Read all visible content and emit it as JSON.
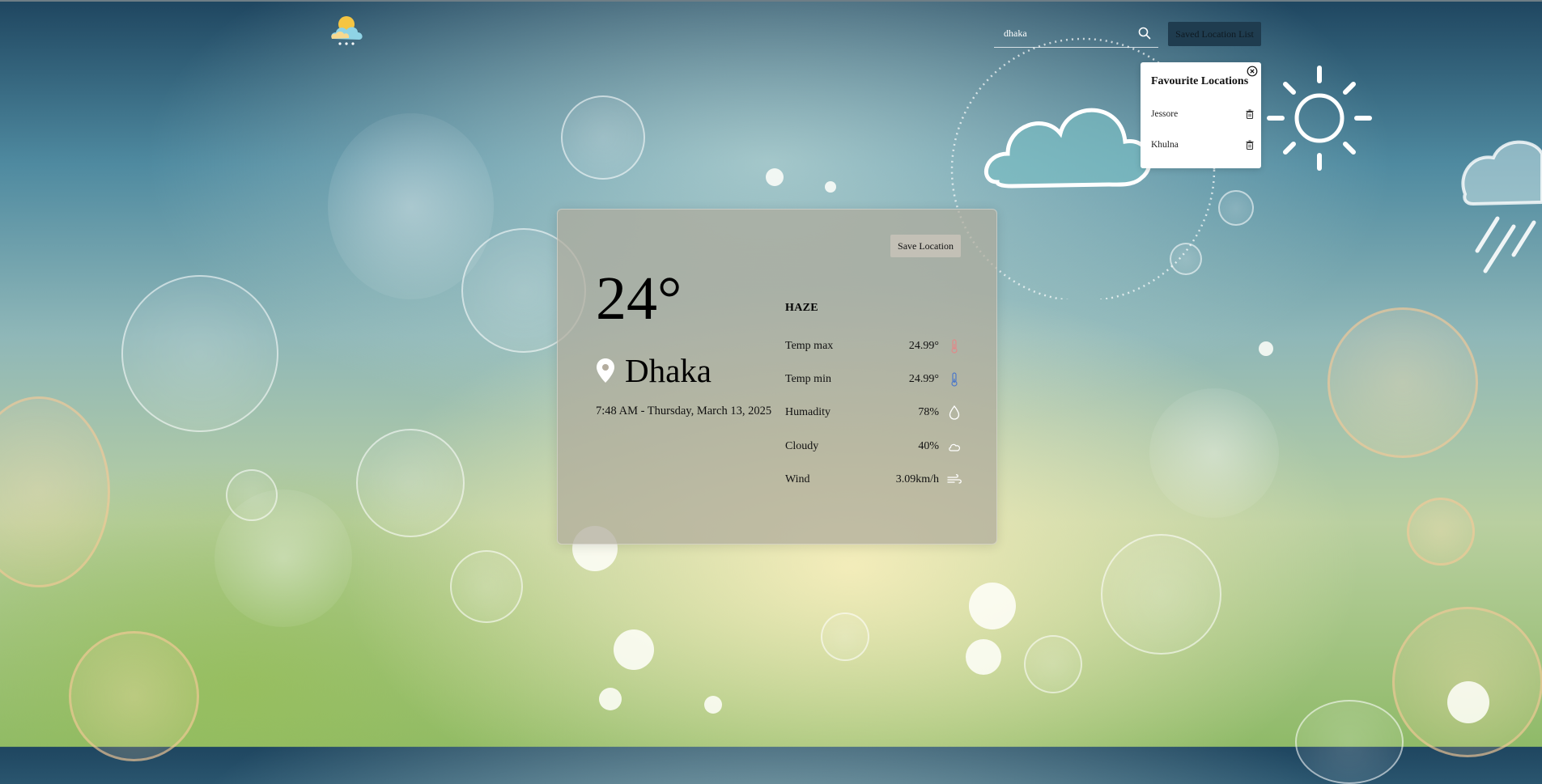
{
  "header": {
    "search": {
      "value": "dhaka",
      "placeholder": ""
    },
    "saved_list_label": "Saved Location List"
  },
  "favourites": {
    "title": "Favourite Locations",
    "items": [
      {
        "label": "Jessore"
      },
      {
        "label": "Khulna"
      }
    ]
  },
  "weather": {
    "save_label": "Save Location",
    "temperature": "24°",
    "city": "Dhaka",
    "datetime": "7:48 AM - Thursday, March 13, 2025",
    "condition": "HAZE",
    "stats": [
      {
        "label": "Temp max",
        "value": "24.99°",
        "icon": "thermometer-hot-icon",
        "color": "#e08a8a"
      },
      {
        "label": "Temp min",
        "value": "24.99°",
        "icon": "thermometer-cold-icon",
        "color": "#4d78c8"
      },
      {
        "label": "Humadity",
        "value": "78%",
        "icon": "droplet-icon",
        "color": "#ffffff"
      },
      {
        "label": "Cloudy",
        "value": "40%",
        "icon": "cloud-icon",
        "color": "#ffffff"
      },
      {
        "label": "Wind",
        "value": "3.09km/h",
        "icon": "wind-icon",
        "color": "#ffffff"
      }
    ]
  },
  "colors": {
    "saved_list_bg": "#1f3c4f",
    "card_bg": "rgba(175,170,155,0.72)"
  }
}
